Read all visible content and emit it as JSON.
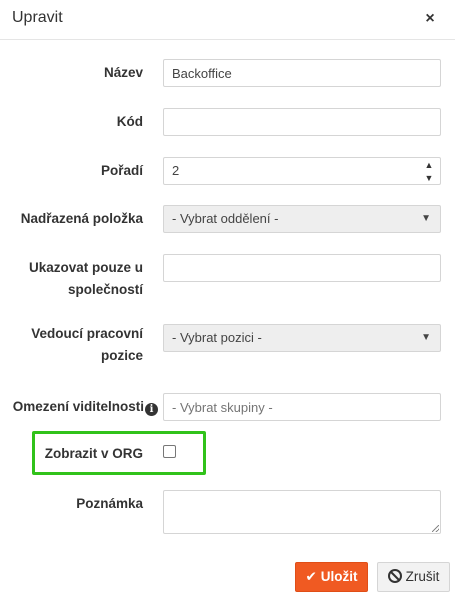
{
  "dialog": {
    "title": "Upravit",
    "close_icon": "×"
  },
  "form": {
    "name": {
      "label": "Název",
      "value": "Backoffice"
    },
    "code": {
      "label": "Kód",
      "value": ""
    },
    "order": {
      "label": "Pořadí",
      "value": "2",
      "up_icon": "▲",
      "down_icon": "▼"
    },
    "parent": {
      "label": "Nadřazená položka",
      "selected": "- Vybrat oddělení -"
    },
    "company": {
      "label_line1": "Ukazovat pouze u",
      "label_line2": "společností",
      "value": ""
    },
    "position": {
      "label_line1": "Vedoucí pracovní",
      "label_line2": "pozice",
      "selected": "- Vybrat pozici -"
    },
    "visibility": {
      "label": "Omezení viditelnosti",
      "info_icon": "i",
      "placeholder": "- Vybrat skupiny -"
    },
    "show_org": {
      "label": "Zobrazit v ORG",
      "checked": false
    },
    "note": {
      "label": "Poznámka",
      "value": ""
    }
  },
  "buttons": {
    "save_label": "Uložit",
    "cancel_label": "Zrušit"
  },
  "colors": {
    "primary": "#f05a22",
    "highlight": "#31c21a"
  }
}
